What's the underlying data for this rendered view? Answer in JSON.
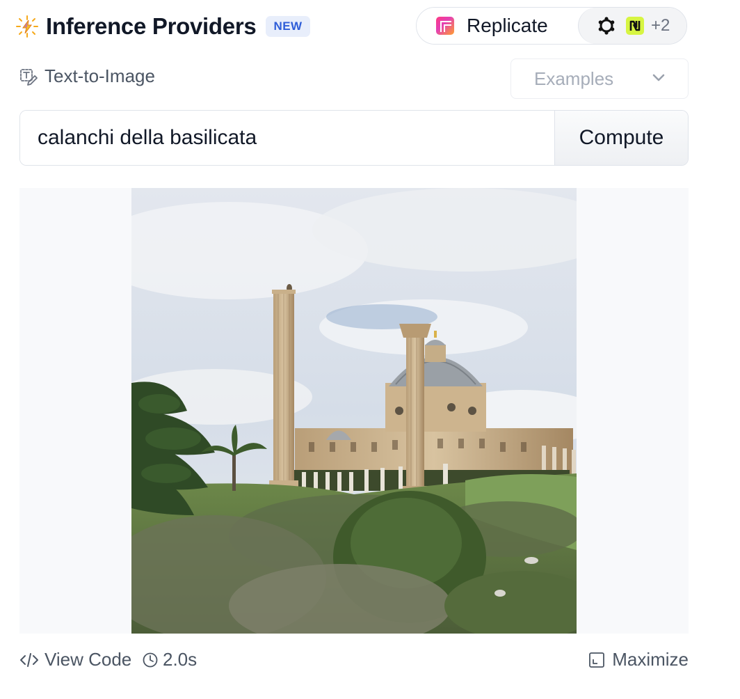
{
  "header": {
    "title": "Inference Providers",
    "badge": "NEW"
  },
  "providers": {
    "selected": "Replicate",
    "more_count": "+2",
    "icons": [
      "replicate-icon",
      "openai-icon",
      "nebius-icon"
    ]
  },
  "task": {
    "label": "Text-to-Image",
    "examples_label": "Examples"
  },
  "prompt": {
    "value": "calanchi della basilicata",
    "button_label": "Compute"
  },
  "output": {
    "image_alt": "Generated image"
  },
  "footer": {
    "view_code_label": "View Code",
    "timing": "2.0s",
    "maximize_label": "Maximize"
  },
  "colors": {
    "badge_bg": "#e8eefb",
    "badge_text": "#2f5ed8",
    "output_bg": "#f8f9fb",
    "muted_text": "#4b5563"
  }
}
